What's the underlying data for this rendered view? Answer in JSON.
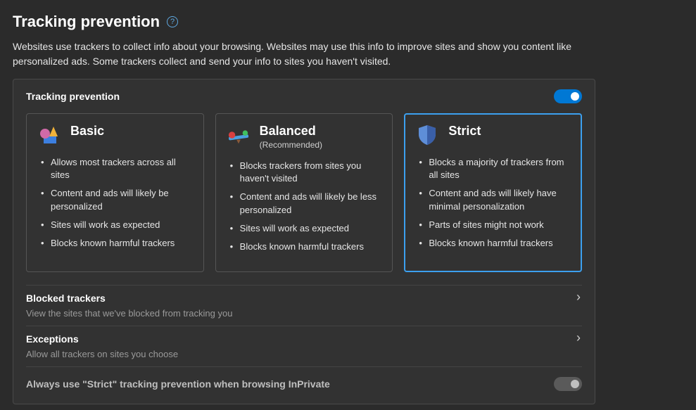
{
  "page": {
    "title": "Tracking prevention",
    "intro": "Websites use trackers to collect info about your browsing. Websites may use this info to improve sites and show you content like personalized ads. Some trackers collect and send your info to sites you haven't visited."
  },
  "panel": {
    "title": "Tracking prevention",
    "toggle_on": true
  },
  "cards": [
    {
      "key": "basic",
      "title": "Basic",
      "subtitle": "",
      "selected": false,
      "bullets": [
        "Allows most trackers across all sites",
        "Content and ads will likely be personalized",
        "Sites will work as expected",
        "Blocks known harmful trackers"
      ]
    },
    {
      "key": "balanced",
      "title": "Balanced",
      "subtitle": "(Recommended)",
      "selected": false,
      "bullets": [
        "Blocks trackers from sites you haven't visited",
        "Content and ads will likely be less personalized",
        "Sites will work as expected",
        "Blocks known harmful trackers"
      ]
    },
    {
      "key": "strict",
      "title": "Strict",
      "subtitle": "",
      "selected": true,
      "bullets": [
        "Blocks a majority of trackers from all sites",
        "Content and ads will likely have minimal personalization",
        "Parts of sites might not work",
        "Blocks known harmful trackers"
      ]
    }
  ],
  "rows": {
    "blocked": {
      "title": "Blocked trackers",
      "sub": "View the sites that we've blocked from tracking you"
    },
    "exceptions": {
      "title": "Exceptions",
      "sub": "Allow all trackers on sites you choose"
    },
    "inprivate": {
      "title": "Always use \"Strict\" tracking prevention when browsing InPrivate",
      "toggle_on": false
    }
  }
}
